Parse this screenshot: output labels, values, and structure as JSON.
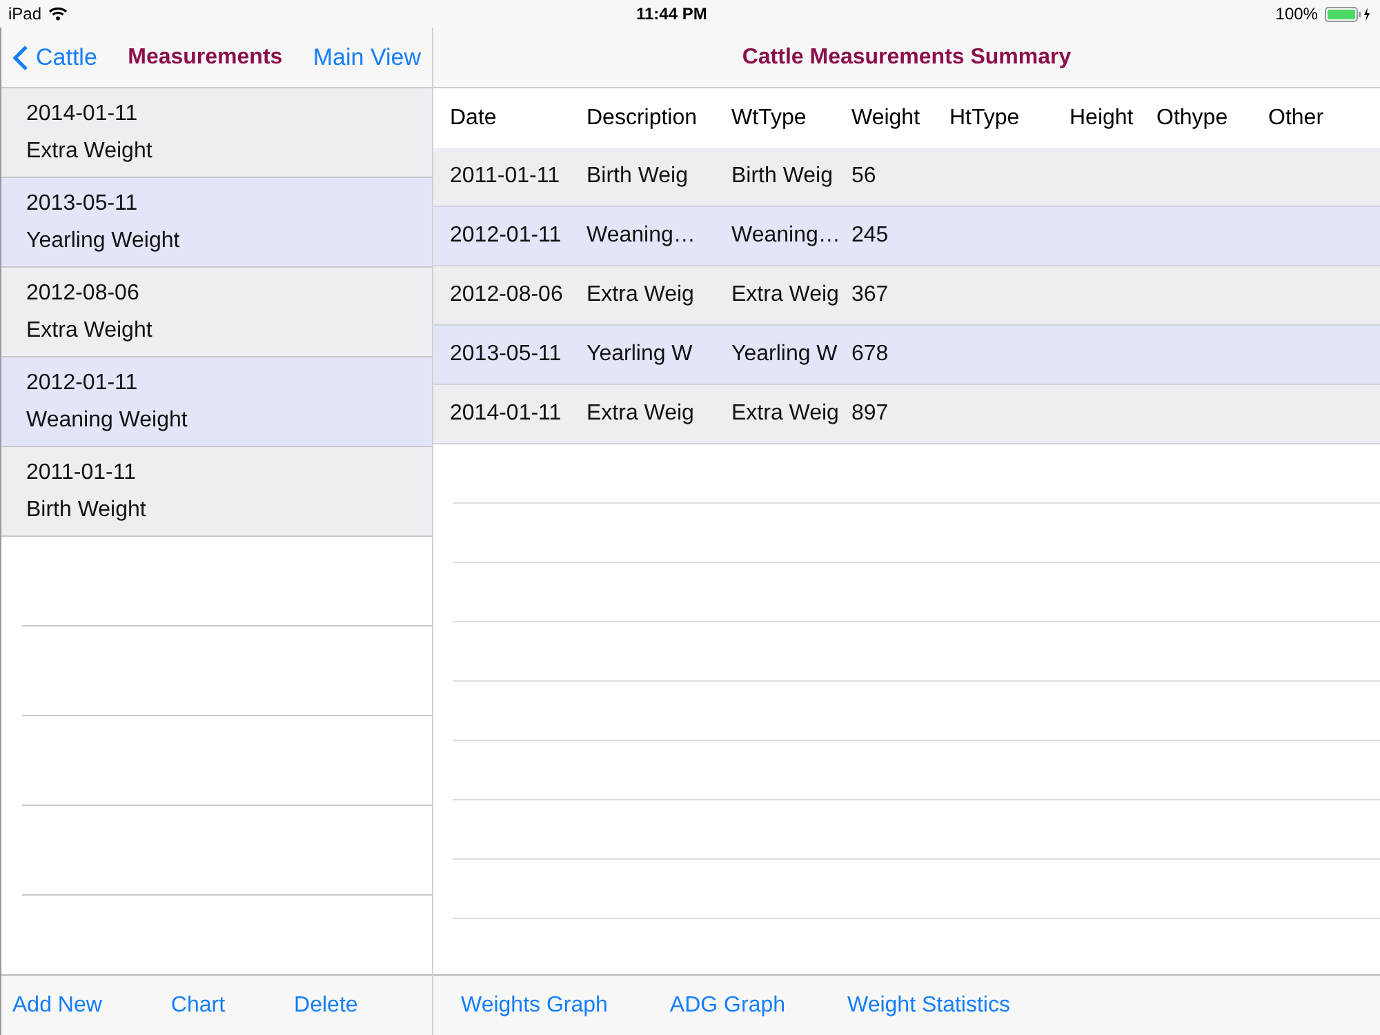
{
  "status_bar": {
    "device": "iPad",
    "time": "11:44 PM",
    "battery": "100%"
  },
  "master": {
    "back": "Cattle",
    "title": "Measurements",
    "action": "Main View",
    "items": [
      {
        "date": "2014-01-11",
        "label": "Extra Weight"
      },
      {
        "date": "2013-05-11",
        "label": "Yearling Weight"
      },
      {
        "date": "2012-08-06",
        "label": "Extra Weight"
      },
      {
        "date": "2012-01-11",
        "label": "Weaning Weight"
      },
      {
        "date": "2011-01-11",
        "label": "Birth Weight"
      }
    ],
    "toolbar": [
      "Add New",
      "Chart",
      "Delete"
    ]
  },
  "detail": {
    "title": "Cattle Measurements Summary",
    "table": {
      "columns": [
        "Date",
        "Description",
        "WtType",
        "Weight",
        "HtType",
        "Height",
        "Othype",
        "Other"
      ],
      "rows": [
        [
          "2011-01-11",
          "Birth Weig",
          "Birth Weig",
          "56"
        ],
        [
          "2012-01-11",
          "Weaning…",
          "Weaning…",
          "245"
        ],
        [
          "2012-08-06",
          "Extra Weig",
          "Extra Weig",
          "367"
        ],
        [
          "2013-05-11",
          "Yearling W",
          "Yearling W",
          "678"
        ],
        [
          "2014-01-11",
          "Extra Weig",
          "Extra Weig",
          "897"
        ]
      ]
    },
    "toolbar": [
      "Weights Graph",
      "ADG Graph",
      "Weight Statistics"
    ]
  }
}
